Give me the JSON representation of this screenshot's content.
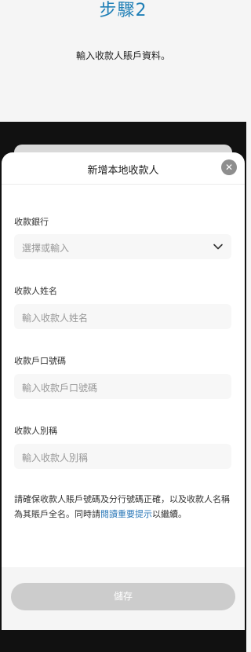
{
  "step": {
    "title": "步驟2",
    "description": "輸入收款人賬戶資料。"
  },
  "sheet": {
    "title": "新增本地收款人",
    "close_icon": "close-icon"
  },
  "fields": {
    "bank": {
      "label": "收款銀行",
      "placeholder": "選擇或輸入",
      "icon": "chevron-down-icon"
    },
    "name": {
      "label": "收款人姓名",
      "placeholder": "輸入收款人姓名"
    },
    "account": {
      "label": "收款戶口號碼",
      "placeholder": "輸入收款戶口號碼"
    },
    "alias": {
      "label": "收款人別稱",
      "placeholder": "輸入收款人別稱"
    }
  },
  "notice": {
    "text_before": "請確保收款人賬戶號碼及分行號碼正確，以及收款人名稱為其賬戶全名。同時請",
    "link_text": "閱讀重要提示",
    "text_after": "以繼續。"
  },
  "footer": {
    "save_label": "儲存"
  },
  "colors": {
    "accent": "#1f7fb6",
    "link": "#2b78b8",
    "disabled_button": "#cccccc"
  }
}
